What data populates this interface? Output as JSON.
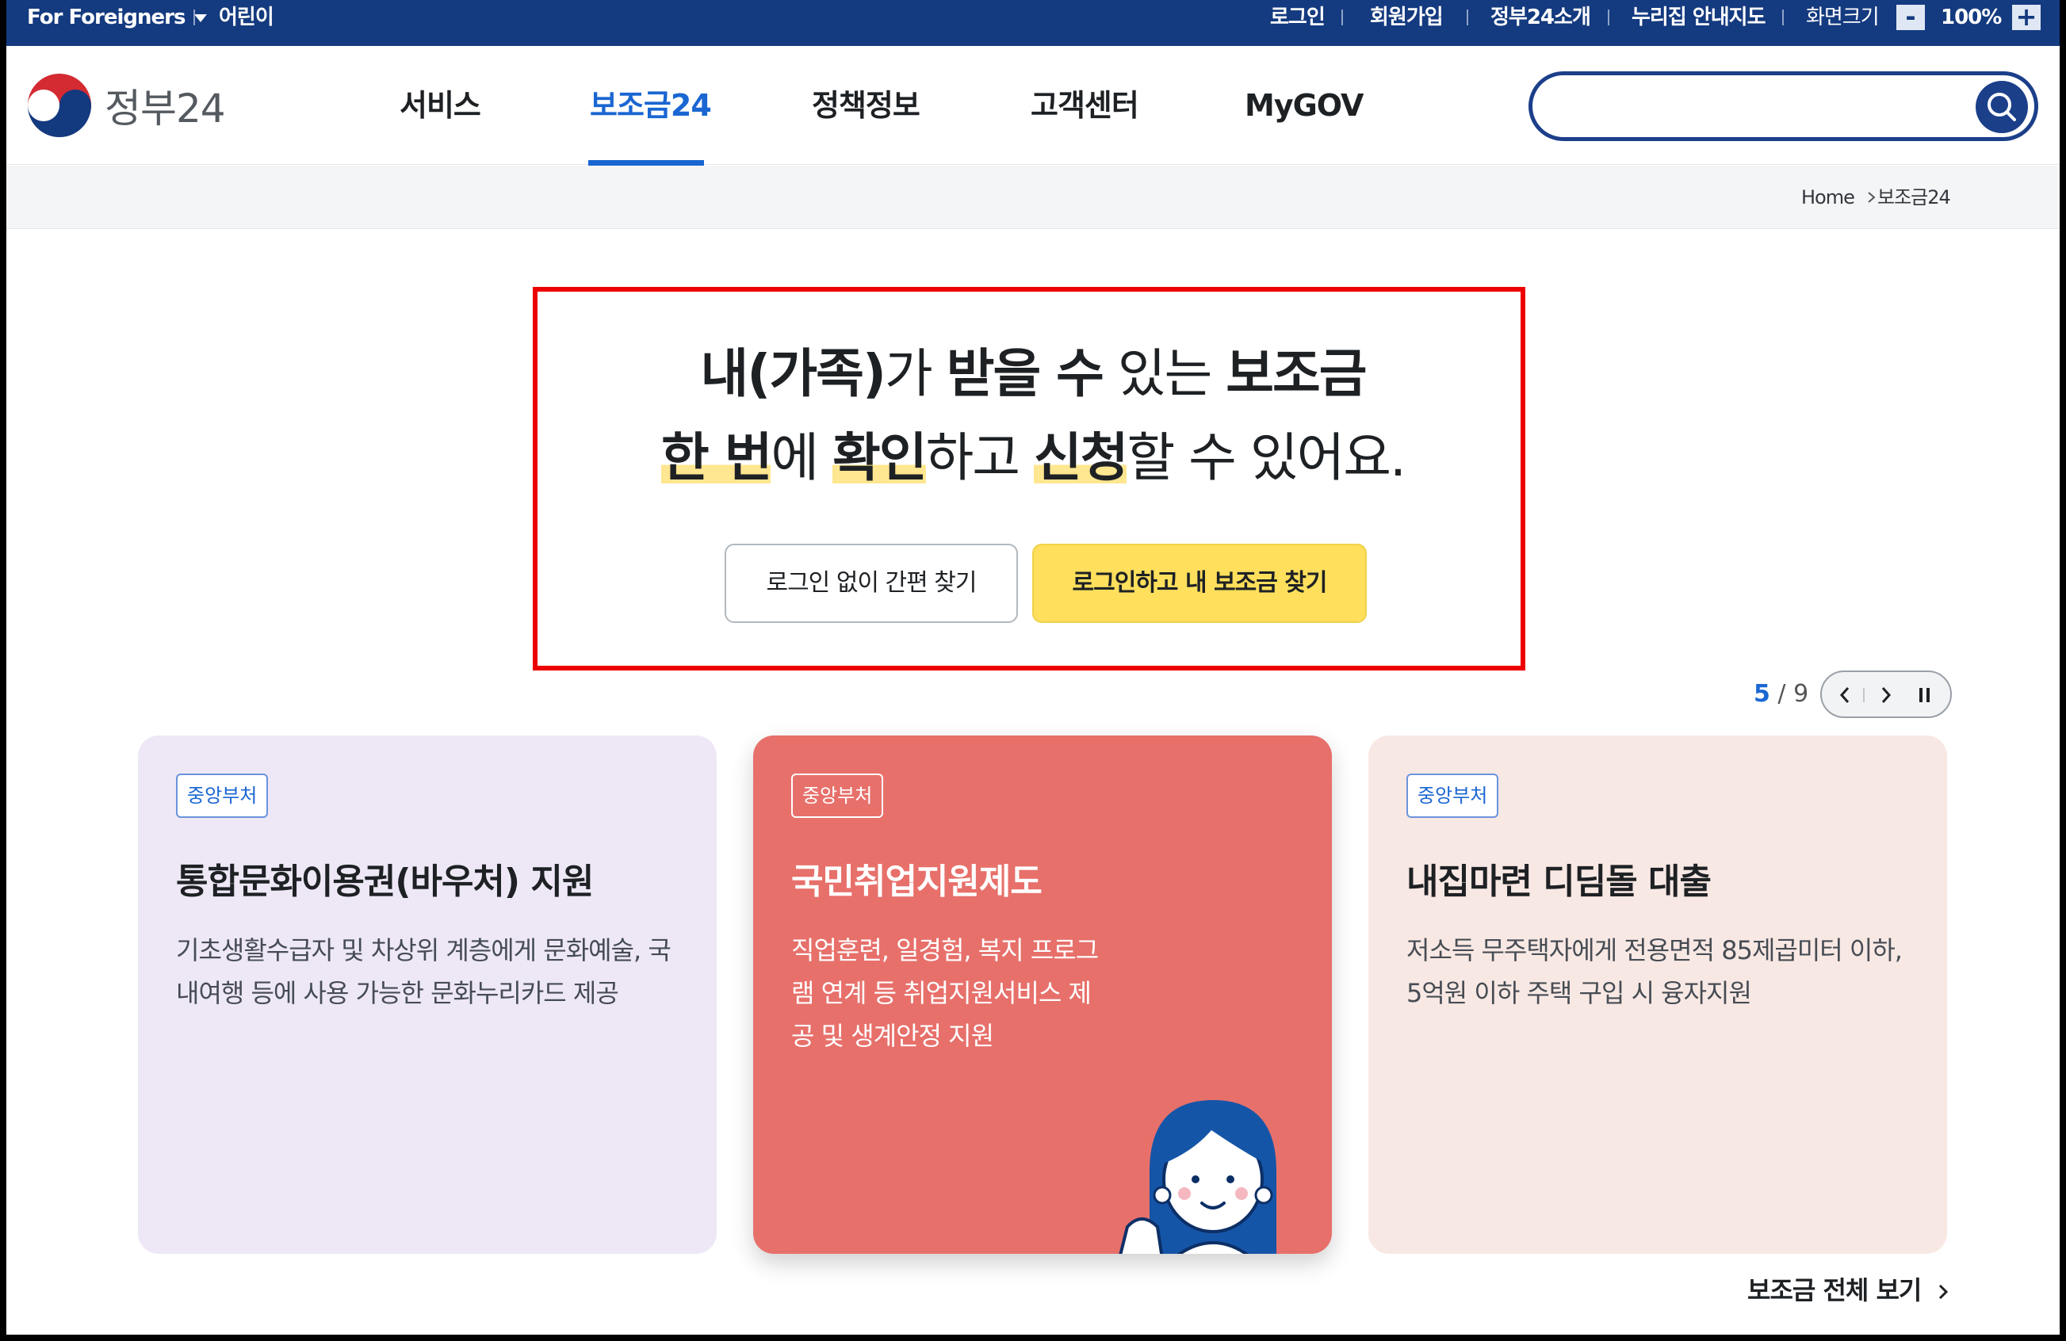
{
  "utility_bar": {
    "foreigners": "For Foreigners",
    "kids": "어린이",
    "login": "로그인",
    "signup": "회원가입",
    "about": "정부24소개",
    "sitemap": "누리집 안내지도",
    "zoom_label": "화면크기",
    "zoom_minus": "-",
    "zoom_value": "100%",
    "zoom_plus": "+"
  },
  "header": {
    "logo_text": "정부24",
    "nav": [
      "서비스",
      "보조금24",
      "정책정보",
      "고객센터",
      "MyGOV"
    ],
    "active_nav": "보조금24",
    "search_placeholder": ""
  },
  "breadcrumb": {
    "home": "Home",
    "current": "보조금24"
  },
  "hero": {
    "line1": {
      "b1": "내(가족)",
      "t1": "가 ",
      "b2": "받을 수",
      "t2": " 있는 ",
      "b3": "보조금"
    },
    "line2": {
      "h1": "한 번",
      "t1": "에 ",
      "h2": "확인",
      "t2": "하고 ",
      "h3": "신청",
      "t3": "할 수 있어요."
    },
    "btn_simple": "로그인 없이 간편 찾기",
    "btn_login": "로그인하고 내 보조금 찾기"
  },
  "pager": {
    "current": "5",
    "sep": "/",
    "total": "9"
  },
  "cards": [
    {
      "tag": "중앙부처",
      "title": "통합문화이용권(바우처) 지원",
      "desc": "기초생활수급자 및 차상위 계층에게 문화예술, 국내여행 등에 사용 가능한 문화누리카드 제공"
    },
    {
      "tag": "중앙부처",
      "title": "국민취업지원제도",
      "desc": "직업훈련, 일경험, 복지 프로그램 연계 등 취업지원서비스 제공 및 생계안정 지원"
    },
    {
      "tag": "중앙부처",
      "title": "내집마련 디딤돌 대출",
      "desc": "저소득 무주택자에게 전용면적 85제곱미터 이하, 5억원 이하 주택 구입 시 융자지원"
    }
  ],
  "see_all": "보조금 전체 보기",
  "colors": {
    "navy": "#143a7f",
    "accent_blue": "#1a66d2",
    "highlight": "#ffe690",
    "hero_border": "#ec0000",
    "yellow_button": "#ffdf5c",
    "card_red": "#e7706b"
  }
}
